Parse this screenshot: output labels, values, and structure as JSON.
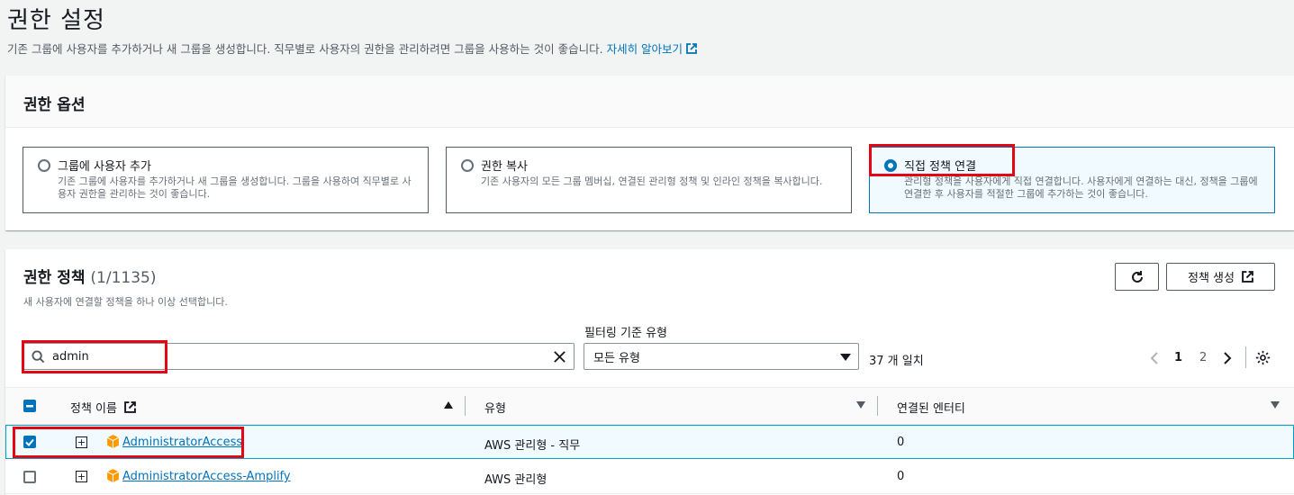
{
  "page": {
    "title": "권한 설정",
    "description": "기존 그룹에 사용자를 추가하거나 새 그룹을 생성합니다. 직무별로 사용자의 권한을 관리하려면 그룹을 사용하는 것이 좋습니다.",
    "learn_more": "자세히 알아보기"
  },
  "options": {
    "header": "권한 옵션",
    "cards": [
      {
        "title": "그룹에 사용자 추가",
        "desc": "기존 그룹에 사용자를 추가하거나 새 그룹을 생성합니다. 그룹을 사용하여 직무별로 사용자 권한을 관리하는 것이 좋습니다.",
        "selected": false
      },
      {
        "title": "권한 복사",
        "desc": "기존 사용자의 모든 그룹 멤버십, 연결된 관리형 정책 및 인라인 정책을 복사합니다.",
        "selected": false
      },
      {
        "title": "직접 정책 연결",
        "desc": "관리형 정책을 사용자에게 직접 연결합니다. 사용자에게 연결하는 대신, 정책을 그룹에 연결한 후 사용자를 적절한 그룹에 추가하는 것이 좋습니다.",
        "selected": true
      }
    ]
  },
  "policies": {
    "title": "권한 정책",
    "count": "(1/1135)",
    "description": "새 사용자에 연결할 정책을 하나 이상 선택합니다.",
    "create_button": "정책 생성",
    "filter_label": "필터링 기준 유형",
    "search_value": "admin",
    "type_select": "모든 유형",
    "match_count": "37 개 일치",
    "pages": [
      "1",
      "2"
    ],
    "current_page": "1",
    "columns": {
      "name": "정책 이름",
      "type": "유형",
      "entities": "연결된 엔터티"
    },
    "rows": [
      {
        "name": "AdministratorAccess",
        "type": "AWS 관리형 - 직무",
        "entities": "0",
        "checked": true
      },
      {
        "name": "AdministratorAccess-Amplify",
        "type": "AWS 관리형",
        "entities": "0",
        "checked": false
      }
    ]
  },
  "colors": {
    "accent": "#0073bb",
    "highlight": "#e30613",
    "selected_bg": "#f1faff"
  },
  "icons": [
    "external-link-icon",
    "refresh-icon",
    "search-icon",
    "clear-icon",
    "caret-down-icon",
    "chevron-left-icon",
    "chevron-right-icon",
    "settings-gear-icon",
    "expand-icon",
    "package-cube-icon",
    "sort-asc-icon",
    "sort-desc-icon"
  ]
}
